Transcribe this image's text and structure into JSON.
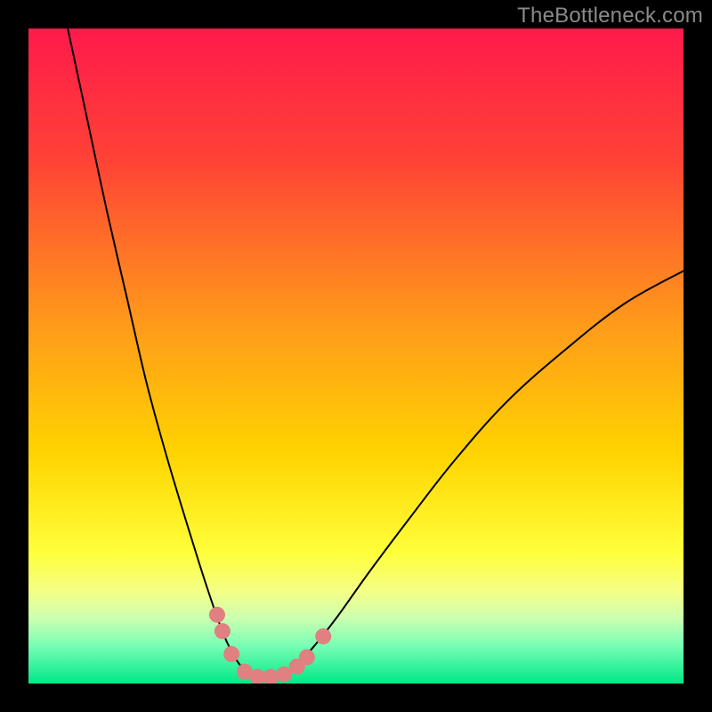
{
  "watermark": "TheBottleneck.com",
  "chart_data": {
    "type": "line",
    "title": "",
    "xlabel": "",
    "ylabel": "",
    "xlim": [
      0,
      100
    ],
    "ylim": [
      0,
      100
    ],
    "background_gradient": {
      "stops": [
        {
          "offset": 0.0,
          "color": "#ff1a4b"
        },
        {
          "offset": 0.2,
          "color": "#ff4236"
        },
        {
          "offset": 0.45,
          "color": "#ff9a1a"
        },
        {
          "offset": 0.65,
          "color": "#ffd400"
        },
        {
          "offset": 0.8,
          "color": "#ffff3a"
        },
        {
          "offset": 0.86,
          "color": "#f4ff87"
        },
        {
          "offset": 0.9,
          "color": "#ccffb0"
        },
        {
          "offset": 0.94,
          "color": "#7dffb5"
        },
        {
          "offset": 1.0,
          "color": "#00e888"
        }
      ]
    },
    "series": [
      {
        "name": "left-curve",
        "type": "line",
        "color": "#000000",
        "width": 2.0,
        "points": [
          {
            "x": 6.0,
            "y": 100.0
          },
          {
            "x": 9.0,
            "y": 86.0
          },
          {
            "x": 12.0,
            "y": 72.0
          },
          {
            "x": 15.0,
            "y": 59.0
          },
          {
            "x": 18.0,
            "y": 46.0
          },
          {
            "x": 21.0,
            "y": 35.0
          },
          {
            "x": 24.0,
            "y": 25.0
          },
          {
            "x": 26.5,
            "y": 17.0
          },
          {
            "x": 28.5,
            "y": 11.0
          },
          {
            "x": 30.0,
            "y": 7.0
          },
          {
            "x": 31.5,
            "y": 4.0
          },
          {
            "x": 33.0,
            "y": 2.0
          },
          {
            "x": 34.5,
            "y": 1.0
          },
          {
            "x": 36.0,
            "y": 1.0
          },
          {
            "x": 38.0,
            "y": 1.0
          }
        ]
      },
      {
        "name": "right-curve",
        "type": "line",
        "color": "#000000",
        "width": 2.0,
        "points": [
          {
            "x": 38.0,
            "y": 1.0
          },
          {
            "x": 40.0,
            "y": 2.0
          },
          {
            "x": 43.0,
            "y": 5.0
          },
          {
            "x": 47.0,
            "y": 10.0
          },
          {
            "x": 52.0,
            "y": 17.0
          },
          {
            "x": 58.0,
            "y": 25.0
          },
          {
            "x": 65.0,
            "y": 34.0
          },
          {
            "x": 73.0,
            "y": 43.0
          },
          {
            "x": 82.0,
            "y": 51.0
          },
          {
            "x": 91.0,
            "y": 58.0
          },
          {
            "x": 100.0,
            "y": 63.0
          }
        ]
      },
      {
        "name": "marker-dots",
        "type": "scatter",
        "color": "#e08080",
        "radius": 9,
        "points": [
          {
            "x": 28.8,
            "y": 10.5
          },
          {
            "x": 29.6,
            "y": 8.0
          },
          {
            "x": 31.0,
            "y": 4.5
          },
          {
            "x": 33.0,
            "y": 1.8
          },
          {
            "x": 35.0,
            "y": 1.0
          },
          {
            "x": 37.0,
            "y": 1.0
          },
          {
            "x": 39.0,
            "y": 1.4
          },
          {
            "x": 41.0,
            "y": 2.6
          },
          {
            "x": 42.5,
            "y": 4.0
          },
          {
            "x": 45.0,
            "y": 7.2
          }
        ]
      }
    ]
  }
}
